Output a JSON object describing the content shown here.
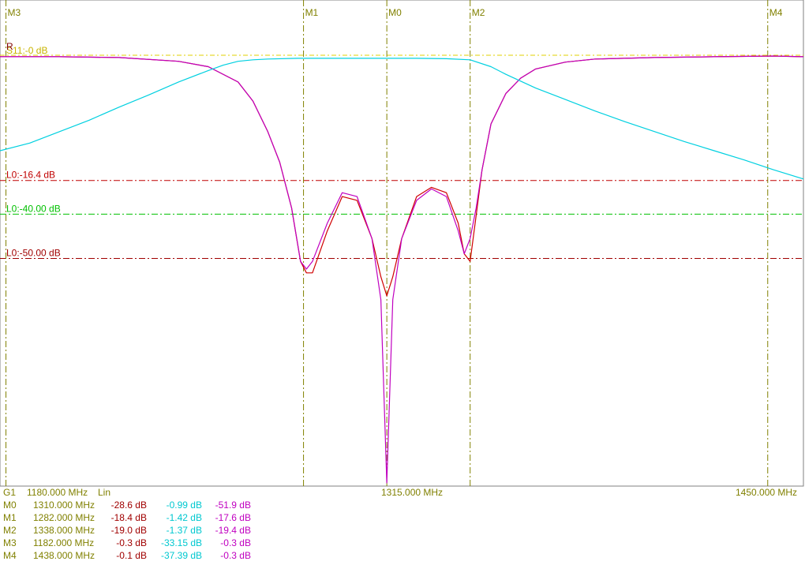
{
  "chart_data": {
    "type": "line",
    "xlim": [
      1180,
      1450
    ],
    "ylim": [
      -56,
      0
    ],
    "grid": false,
    "x_axis": {
      "left_label": "1180.000 MHz",
      "center_label": "1315.000 MHz",
      "right_label": "1450.000 MHz",
      "scale_label": "Lin",
      "group_label": "G1"
    },
    "reference_marker": "R",
    "ref_line_label": "S11:-0 dB",
    "limit_lines": [
      {
        "label": "L0:-16.4 dB",
        "value": -16.4,
        "color": "#c00000"
      },
      {
        "label": "L0:-40.00 dB",
        "value": -20.8,
        "color": "#00c000"
      },
      {
        "label": "L0:-50.00 dB",
        "value": -26.6,
        "color": "#a00000"
      }
    ],
    "series": [
      {
        "color": "#d00000",
        "x": [
          1180,
          1200,
          1220,
          1240,
          1250,
          1260,
          1265,
          1270,
          1274,
          1278,
          1281,
          1283,
          1285,
          1290,
          1295,
          1300,
          1305,
          1308,
          1310,
          1312,
          1315,
          1320,
          1325,
          1330,
          1334,
          1336,
          1338,
          1340,
          1342,
          1345,
          1350,
          1355,
          1360,
          1370,
          1380,
          1400,
          1420,
          1440,
          1450
        ],
        "y": [
          -0.2,
          -0.2,
          -0.3,
          -0.8,
          -1.5,
          -3.5,
          -6,
          -10,
          -14,
          -20,
          -27,
          -28.5,
          -28.5,
          -23,
          -18.5,
          -19,
          -24,
          -29,
          -31.5,
          -29,
          -24,
          -18.5,
          -17.3,
          -18,
          -22,
          -26,
          -27,
          -21,
          -15,
          -9,
          -5,
          -3,
          -1.8,
          -0.9,
          -0.5,
          -0.3,
          -0.2,
          -0.1,
          -0.2
        ]
      },
      {
        "color": "#c000c0",
        "x": [
          1180,
          1200,
          1220,
          1240,
          1250,
          1260,
          1265,
          1270,
          1274,
          1278,
          1281,
          1283,
          1285,
          1290,
          1295,
          1300,
          1305,
          1308,
          1310,
          1312,
          1315,
          1320,
          1325,
          1330,
          1334,
          1336,
          1338,
          1340,
          1342,
          1345,
          1350,
          1355,
          1360,
          1370,
          1380,
          1400,
          1420,
          1440,
          1450
        ],
        "y": [
          -0.2,
          -0.2,
          -0.3,
          -0.8,
          -1.5,
          -3.5,
          -6,
          -10,
          -14,
          -20,
          -27,
          -28,
          -27,
          -22,
          -18,
          -18.5,
          -24,
          -32,
          -56,
          -32,
          -24,
          -19,
          -17.5,
          -18.5,
          -23,
          -26,
          -24,
          -20,
          -15,
          -9,
          -5,
          -3,
          -1.8,
          -0.9,
          -0.5,
          -0.3,
          -0.2,
          -0.1,
          -0.2
        ]
      },
      {
        "color": "#00d0e0",
        "x": [
          1180,
          1190,
          1200,
          1210,
          1220,
          1230,
          1240,
          1250,
          1255,
          1260,
          1265,
          1270,
          1280,
          1300,
          1320,
          1330,
          1338,
          1345,
          1350,
          1360,
          1370,
          1380,
          1390,
          1400,
          1410,
          1420,
          1430,
          1440,
          1450
        ],
        "y": [
          -12.5,
          -11.5,
          -10,
          -8.5,
          -6.8,
          -5.2,
          -3.5,
          -2,
          -1.3,
          -0.8,
          -0.6,
          -0.5,
          -0.4,
          -0.4,
          -0.4,
          -0.45,
          -0.6,
          -1.5,
          -2.5,
          -4.3,
          -5.8,
          -7.3,
          -8.7,
          -10,
          -11.3,
          -12.5,
          -13.7,
          -15,
          -16.2
        ]
      }
    ],
    "markers": [
      {
        "name": "M0",
        "x": 1310
      },
      {
        "name": "M1",
        "x": 1282
      },
      {
        "name": "M2",
        "x": 1338
      },
      {
        "name": "M3",
        "x": 1182
      },
      {
        "name": "M4",
        "x": 1438
      }
    ],
    "marker_table": [
      {
        "name": "M0",
        "freq": "1310.000 MHz",
        "v0": "-28.6 dB",
        "v1": "-0.99 dB",
        "v2": "-51.9 dB"
      },
      {
        "name": "M1",
        "freq": "1282.000 MHz",
        "v0": "-18.4 dB",
        "v1": "-1.42 dB",
        "v2": "-17.6 dB"
      },
      {
        "name": "M2",
        "freq": "1338.000 MHz",
        "v0": "-19.0 dB",
        "v1": "-1.37 dB",
        "v2": "-19.4 dB"
      },
      {
        "name": "M3",
        "freq": "1182.000 MHz",
        "v0": "-0.3 dB",
        "v1": "-33.15 dB",
        "v2": "-0.3 dB"
      },
      {
        "name": "M4",
        "freq": "1438.000 MHz",
        "v0": "-0.1 dB",
        "v1": "-37.39 dB",
        "v2": "-0.3 dB"
      }
    ]
  }
}
